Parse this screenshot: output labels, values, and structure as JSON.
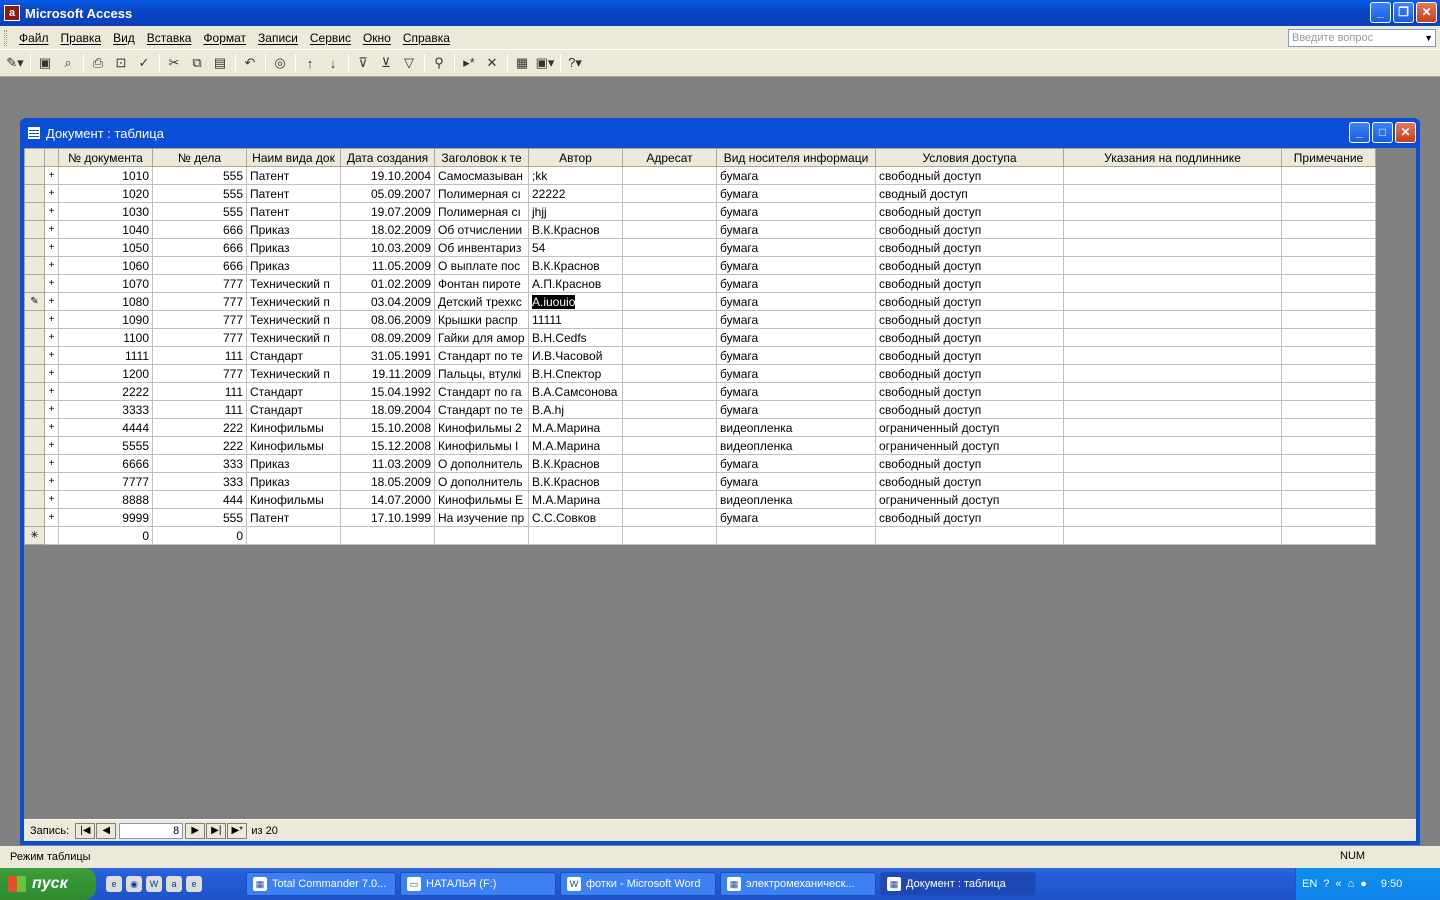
{
  "app": {
    "title": "Microsoft Access"
  },
  "menu": {
    "items": [
      "Файл",
      "Правка",
      "Вид",
      "Вставка",
      "Формат",
      "Записи",
      "Сервис",
      "Окно",
      "Справка"
    ],
    "ask_placeholder": "Введите вопрос"
  },
  "toolbar": {
    "icons": [
      "design-view-icon",
      "save-icon",
      "file-search-icon",
      "print-icon",
      "print-preview-icon",
      "spelling-icon",
      "cut-icon",
      "copy-icon",
      "paste-icon",
      "undo-icon",
      "hyperlink-icon",
      "sort-ascending-icon",
      "sort-descending-icon",
      "filter-by-selection-icon",
      "filter-by-form-icon",
      "apply-filter-icon",
      "find-icon",
      "new-record-icon",
      "delete-record-icon",
      "database-window-icon",
      "new-object-icon",
      "help-icon"
    ]
  },
  "docwindow": {
    "title": "Документ : таблица"
  },
  "table": {
    "columns": [
      "№ документа",
      "№ дела",
      "Наим вида док",
      "Дата создания",
      "Заголовок к те",
      "Автор",
      "Адресат",
      "Вид носителя информаци",
      "Условия доступа",
      "Указания на подлиннике",
      "Примечание"
    ],
    "rows": [
      [
        "1010",
        "555",
        "Патент",
        "19.10.2004",
        "Самосмазыван",
        ";kk",
        "",
        "бумага",
        "свободный доступ",
        "",
        ""
      ],
      [
        "1020",
        "555",
        "Патент",
        "05.09.2007",
        "Полимерная сı",
        "22222",
        "",
        "бумага",
        "сводный доступ",
        "",
        ""
      ],
      [
        "1030",
        "555",
        "Патент",
        "19.07.2009",
        "Полимерная сı",
        "jhjj",
        "",
        "бумага",
        "свободный доступ",
        "",
        ""
      ],
      [
        "1040",
        "666",
        "Приказ",
        "18.02.2009",
        "Об отчислении",
        "В.К.Краснов",
        "",
        "бумага",
        "свободный доступ",
        "",
        ""
      ],
      [
        "1050",
        "666",
        "Приказ",
        "10.03.2009",
        "Об инвентариз",
        "54",
        "",
        "бумага",
        "свободный доступ",
        "",
        ""
      ],
      [
        "1060",
        "666",
        "Приказ",
        "11.05.2009",
        "О выплате пос",
        "В.К.Краснов",
        "",
        "бумага",
        "свободный доступ",
        "",
        ""
      ],
      [
        "1070",
        "777",
        "Технический п",
        "01.02.2009",
        "Фонтан пироте",
        "А.П.Краснов",
        "",
        "бумага",
        "свободный доступ",
        "",
        ""
      ],
      [
        "1080",
        "777",
        "Технический п",
        "03.04.2009",
        "Детский трехкс",
        "A.iuouio",
        "",
        "бумага",
        "свободный доступ",
        "",
        ""
      ],
      [
        "1090",
        "777",
        "Технический п",
        "08.06.2009",
        "Крышки распр",
        "11111",
        "",
        "бумага",
        "свободный доступ",
        "",
        ""
      ],
      [
        "1100",
        "777",
        "Технический п",
        "08.09.2009",
        "Гайки для амор",
        "В.Н.Cedfs",
        "",
        "бумага",
        "свободный доступ",
        "",
        ""
      ],
      [
        "1111",
        "111",
        "Стандарт",
        "31.05.1991",
        "Стандарт по те",
        "И.В.Часовой",
        "",
        "бумага",
        "свободный доступ",
        "",
        ""
      ],
      [
        "1200",
        "777",
        "Технический п",
        "19.11.2009",
        "Пальцы, втулкі",
        "В.Н.Спектор",
        "",
        "бумага",
        "свободный доступ",
        "",
        ""
      ],
      [
        "2222",
        "111",
        "Стандарт",
        "15.04.1992",
        "Стандарт по га",
        "В.А.Самсонова",
        "",
        "бумага",
        "свободный доступ",
        "",
        ""
      ],
      [
        "3333",
        "111",
        "Стандарт",
        "18.09.2004",
        "Стандарт по те",
        "В.А.hj",
        "",
        "бумага",
        "свободный доступ",
        "",
        ""
      ],
      [
        "4444",
        "222",
        "Кинофильмы",
        "15.10.2008",
        "Кинофильмы 2",
        "М.А.Марина",
        "",
        "видеопленка",
        "ограниченный доступ",
        "",
        ""
      ],
      [
        "5555",
        "222",
        "Кинофильмы",
        "15.12.2008",
        "Кинофильмы  I",
        "М.А.Марина",
        "",
        "видеопленка",
        "ограниченный доступ",
        "",
        ""
      ],
      [
        "6666",
        "333",
        "Приказ",
        "11.03.2009",
        "О дополнитель",
        "В.К.Краснов",
        "",
        "бумага",
        "свободный доступ",
        "",
        ""
      ],
      [
        "7777",
        "333",
        "Приказ",
        "18.05.2009",
        "О дополнитель",
        "В.К.Краснов",
        "",
        "бумага",
        "свободный доступ",
        "",
        ""
      ],
      [
        "8888",
        "444",
        "Кинофильмы",
        "14.07.2000",
        "Кинофильмы  Е",
        "М.А.Марина",
        "",
        "видеопленка",
        "ограниченный доступ",
        "",
        ""
      ],
      [
        "9999",
        "555",
        "Патент",
        "17.10.1999",
        "На изучение пр",
        "С.С.Совков",
        "",
        "бумага",
        "свободный доступ",
        "",
        ""
      ]
    ],
    "new_row": [
      "0",
      "0"
    ],
    "expand_symbol": "+",
    "new_row_symbol": "✳",
    "edit_symbol": "✎",
    "editing_row_index": 7
  },
  "nav": {
    "label": "Запись:",
    "current": "8",
    "of_label": "из",
    "total": "20"
  },
  "status": {
    "mode": "Режим таблицы",
    "num": "NUM"
  },
  "taskbar": {
    "start": "пуск",
    "buttons": [
      "Total Commander 7.0...",
      "НАТАЛЬЯ (F:)",
      "фотки - Microsoft Word",
      "электромеханическ...",
      "Документ : таблица"
    ],
    "lang": "EN",
    "clock": "9:50"
  },
  "colors": {
    "titlebar": "#0a5de8",
    "highlight": "#000000",
    "taskbar": "#245edb",
    "start": "#3c9e3c"
  }
}
